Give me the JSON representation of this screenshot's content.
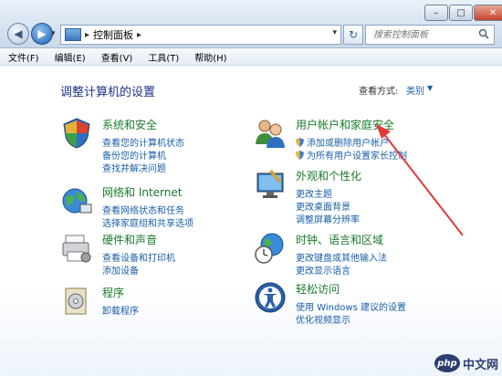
{
  "address": {
    "path": "控制面板"
  },
  "search": {
    "placeholder": "搜索控制面板"
  },
  "menu": [
    "文件(F)",
    "编辑(E)",
    "查看(V)",
    "工具(T)",
    "帮助(H)"
  ],
  "main": {
    "heading": "调整计算机的设置",
    "view_by_label": "查看方式:",
    "view_by_value": "类别"
  },
  "categories": [
    {
      "title": "系统和安全",
      "icon": "shield-icon",
      "links": [
        "查看您的计算机状态",
        "备份您的计算机",
        "查找并解决问题"
      ]
    },
    {
      "title": "网络和 Internet",
      "icon": "network-globe-icon",
      "links": [
        "查看网络状态和任务",
        "选择家庭组和共享选项"
      ]
    },
    {
      "title": "硬件和声音",
      "icon": "printer-icon",
      "links": [
        "查看设备和打印机",
        "添加设备"
      ]
    },
    {
      "title": "程序",
      "icon": "programs-icon",
      "links": [
        "卸载程序"
      ]
    },
    {
      "title": "用户帐户和家庭安全",
      "icon": "users-icon",
      "links": [
        "添加或删除用户帐户",
        "为所有用户设置家长控制"
      ]
    },
    {
      "title": "外观和个性化",
      "icon": "appearance-icon",
      "links": [
        "更改主题",
        "更改桌面背景",
        "调整屏幕分辨率"
      ]
    },
    {
      "title": "时钟、语言和区域",
      "icon": "clock-globe-icon",
      "links": [
        "更改键盘或其他输入法",
        "更改显示语言"
      ]
    },
    {
      "title": "轻松访问",
      "icon": "ease-of-access-icon",
      "links": [
        "使用 Windows 建议的设置",
        "优化视频显示"
      ]
    }
  ],
  "watermark": {
    "logo": "php",
    "text": "中文网"
  },
  "colors": {
    "category_title": "#1a7a2c",
    "link": "#1a5ea8",
    "heading": "#1e3287",
    "annotation_arrow": "#e03a3a"
  }
}
